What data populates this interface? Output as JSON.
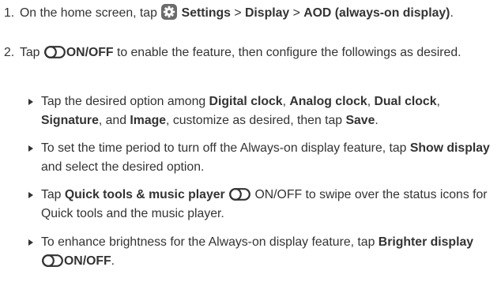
{
  "steps": [
    {
      "number": "1.",
      "t0": "On the home screen, tap",
      "settings": "Settings",
      "sep1": ">",
      "display": "Display",
      "sep2": ">",
      "aod": "AOD (always-on display)",
      "end": "."
    },
    {
      "number": "2.",
      "t0": "Tap",
      "onoff": "ON/OFF",
      "t1": "to enable the feature, then configure the followings as desired."
    }
  ],
  "bullets": [
    {
      "t0": "Tap the desired option among",
      "digital": "Digital clock",
      "c1": ",",
      "analog": "Analog clock",
      "c2": ",",
      "dual": "Dual clock",
      "c3": ",",
      "signature": "Signature",
      "c4": ", and",
      "image": "Image",
      "t1": ", customize as desired, then tap",
      "save": "Save",
      "end": "."
    },
    {
      "t0": "To set the time period to turn off the Always-on display feature, tap",
      "show_display": "Show display",
      "t1": "and select the desired option."
    },
    {
      "t0": "Tap",
      "quick_tools": "Quick tools & music player",
      "onoff": "ON/OFF",
      "t1": "to swipe over the status icons for Quick tools and the music player."
    },
    {
      "t0": "To enhance brightness for the Always-on display feature, tap",
      "brighter": "Brighter display",
      "onoff": "ON/OFF",
      "end": "."
    }
  ],
  "icons": {
    "settings": "gear-icon",
    "toggle": "toggle-switch-icon",
    "bullet": "triangle-bullet-icon"
  },
  "colors": {
    "text": "#333333",
    "gear_bg": "#6b6b6b"
  }
}
